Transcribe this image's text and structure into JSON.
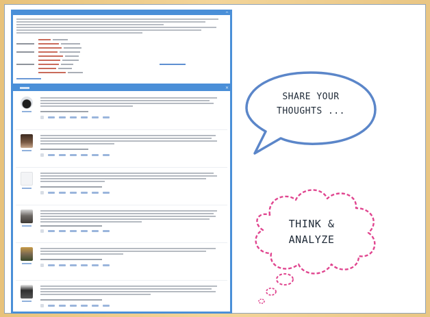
{
  "bubbles": {
    "share_line1": "SHARE YOUR",
    "share_line2": "THOUGHTS ...",
    "think_line1": "THINK &",
    "think_line2": "ANALYZE"
  },
  "colors": {
    "frame_blue": "#4a8fd8",
    "speech_outline": "#5b86c9",
    "thought_outline": "#e0458f"
  },
  "icons": {
    "speech": "speech-bubble-icon",
    "thought": "thought-cloud-icon"
  }
}
